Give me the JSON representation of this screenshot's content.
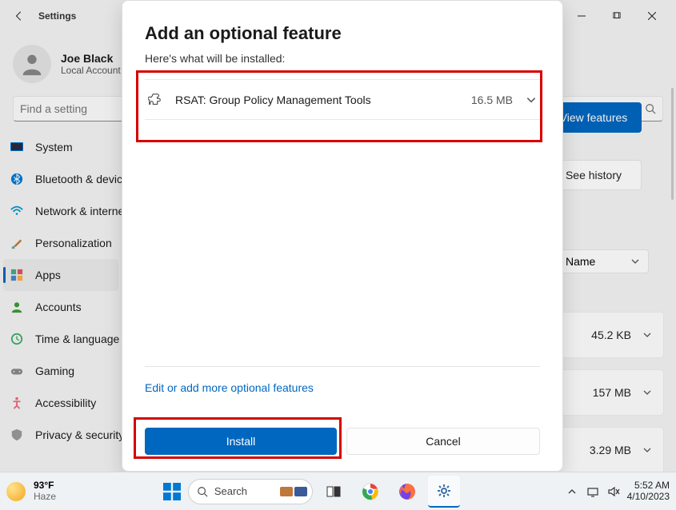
{
  "titlebar": {
    "title": "Settings"
  },
  "user": {
    "name": "Joe Black",
    "type": "Local Account"
  },
  "search": {
    "placeholder": "Find a setting"
  },
  "sidebar": {
    "items": [
      {
        "label": "System"
      },
      {
        "label": "Bluetooth & devices"
      },
      {
        "label": "Network & internet"
      },
      {
        "label": "Personalization"
      },
      {
        "label": "Apps"
      },
      {
        "label": "Accounts"
      },
      {
        "label": "Time & language"
      },
      {
        "label": "Gaming"
      },
      {
        "label": "Accessibility"
      },
      {
        "label": "Privacy & security"
      }
    ]
  },
  "main": {
    "view_features": "View features",
    "see_history": "See history",
    "sort_label": "Name",
    "rows": [
      {
        "size": "45.2 KB"
      },
      {
        "size": "157 MB"
      },
      {
        "size": "3.29 MB"
      }
    ]
  },
  "dialog": {
    "title": "Add an optional feature",
    "subtitle": "Here's what will be installed:",
    "items": [
      {
        "name": "RSAT: Group Policy Management Tools",
        "size": "16.5 MB"
      }
    ],
    "edit_link": "Edit or add more optional features",
    "install": "Install",
    "cancel": "Cancel"
  },
  "taskbar": {
    "temp": "93°F",
    "weather": "Haze",
    "search_placeholder": "Search",
    "time": "5:52 AM",
    "date": "4/10/2023"
  }
}
